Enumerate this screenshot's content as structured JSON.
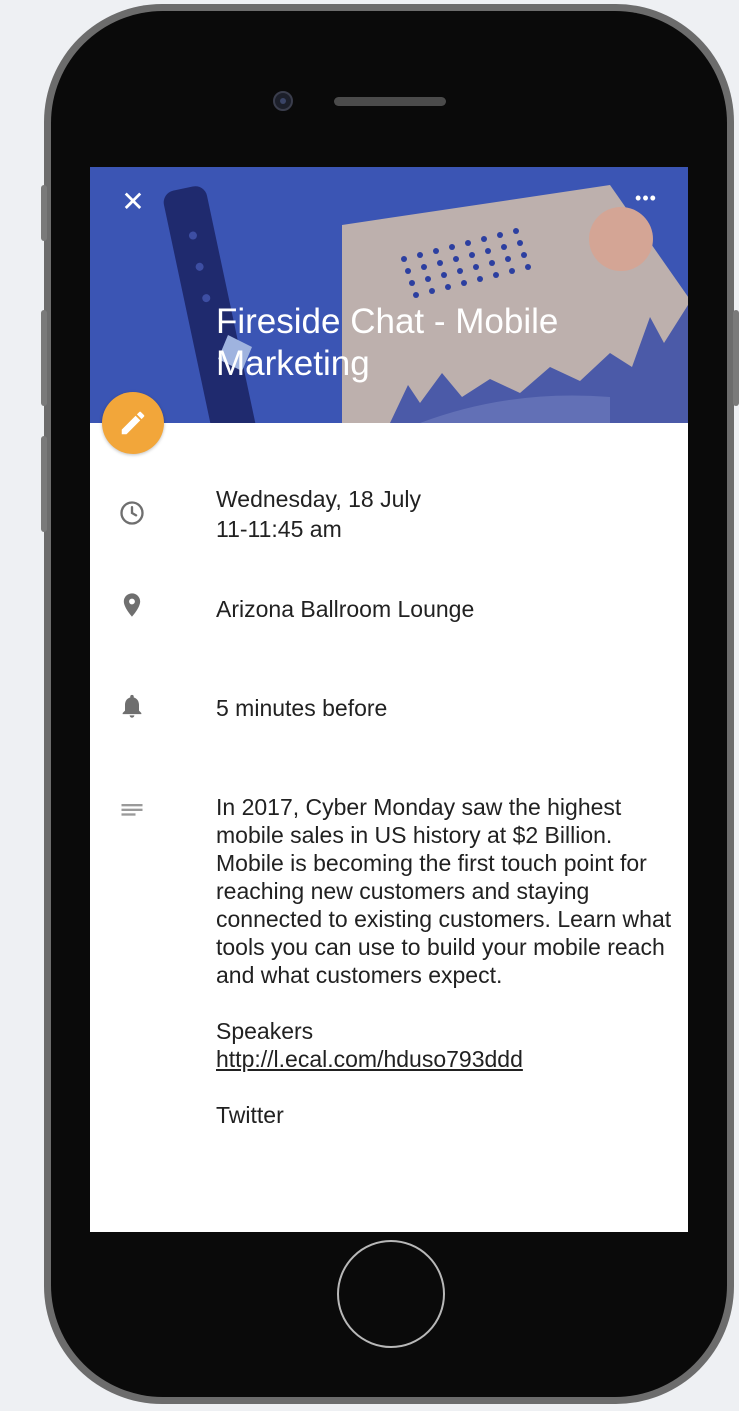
{
  "event": {
    "title": "Fireside Chat - Mobile Marketing",
    "date": "Wednesday, 18 July",
    "time": "11-11:45 am",
    "location": "Arizona Ballroom Lounge",
    "reminder": "5 minutes before",
    "description": "In 2017, Cyber Monday saw the highest mobile sales in US history at $2 Billion. Mobile is becoming the first touch point for reaching new customers and staying connected to existing customers. Learn what tools you can use to build your mobile reach and what customers expect.",
    "speakers_label": "Speakers",
    "speakers_link": "http://l.ecal.com/hduso793ddd",
    "twitter_label": "Twitter"
  },
  "toolbar": {
    "close_glyph": "✕",
    "more_glyph": "•••"
  },
  "icons": {
    "close": "close-icon",
    "more": "more-icon",
    "edit": "pencil-icon",
    "time": "clock-icon",
    "location": "location-pin-icon",
    "reminder": "bell-icon",
    "description": "notes-icon"
  },
  "colors": {
    "header_blue": "#3b55b4",
    "fab_orange": "#f2a63a",
    "card_beige": "#bdb0ad",
    "dark_navy": "#1f2a6e",
    "icon_gray": "#6f6f6f"
  }
}
